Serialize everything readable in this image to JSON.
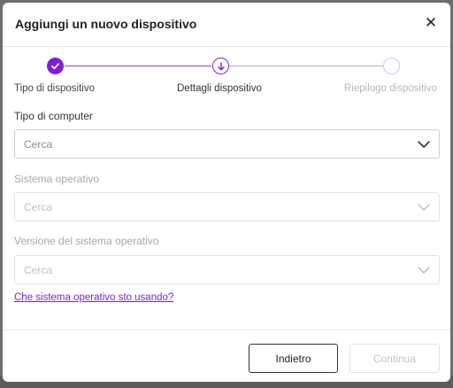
{
  "dialog": {
    "title": "Aggiungi un nuovo dispositivo",
    "close_label": "✕"
  },
  "stepper": {
    "steps": [
      {
        "label": "Tipo di dispositivo",
        "state": "completed"
      },
      {
        "label": "Dettagli dispositivo",
        "state": "current"
      },
      {
        "label": "Riepilogo dispositivo",
        "state": "upcoming"
      }
    ]
  },
  "form": {
    "computer_type": {
      "label": "Tipo di computer",
      "value": "Cerca",
      "enabled": true
    },
    "os": {
      "label": "Sistema operativo",
      "value": "Cerca",
      "enabled": false
    },
    "os_version": {
      "label": "Versione del sistema operativo",
      "value": "Cerca",
      "enabled": false
    },
    "help_link": "Che sistema operativo sto usando?"
  },
  "footer": {
    "back_label": "Indietro",
    "continue_label": "Continua"
  },
  "colors": {
    "accent": "#7c1fd8",
    "accent_light": "#d9bff5"
  }
}
